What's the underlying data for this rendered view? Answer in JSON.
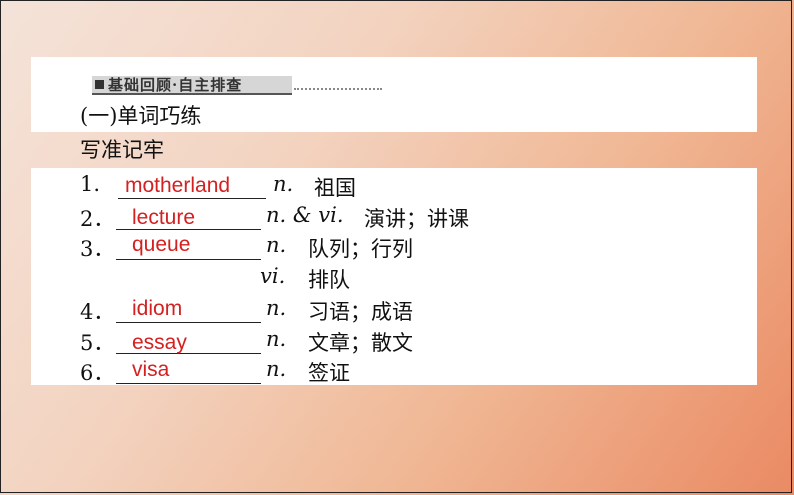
{
  "header": {
    "label": "基础回顾·自主排查"
  },
  "section_title": "(一)单词巧练",
  "subtitle": "写准记牢",
  "rows": [
    {
      "num": "1.",
      "answer": "motherland",
      "pos": "n.",
      "meaning": "祖国"
    },
    {
      "num": "2．",
      "answer": "lecture",
      "pos": "n. & vi.",
      "meaning": "演讲；讲课"
    },
    {
      "num": "3．",
      "answer": "queue",
      "pos": "n.",
      "meaning": "队列；行列"
    },
    {
      "num": "",
      "answer": "",
      "pos": "vi.",
      "meaning": "排队"
    },
    {
      "num": "4．",
      "answer": "idiom",
      "pos": "n.",
      "meaning": "习语；成语"
    },
    {
      "num": "5．",
      "answer": "essay",
      "pos": "n.",
      "meaning": "文章；散文"
    },
    {
      "num": "6．",
      "answer": "visa",
      "pos": "n.",
      "meaning": "签证"
    }
  ]
}
